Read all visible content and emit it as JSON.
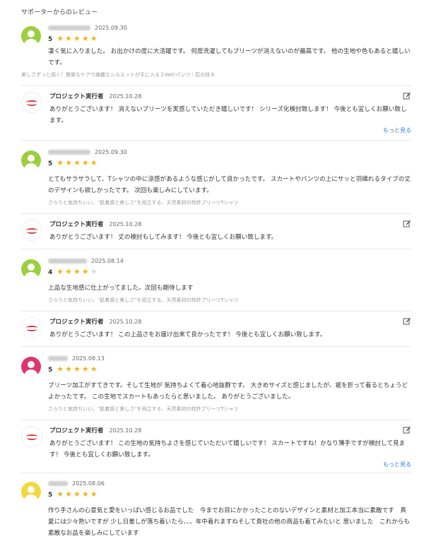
{
  "section_title": "サポーターからのレビュー",
  "colors": {
    "star": "#f0b41c",
    "link": "#2a7fd4"
  },
  "reviews": [
    {
      "avatar_color": "#9bcf3f",
      "date": "2025.09.30",
      "rating": "5",
      "stars": "★★★★★",
      "stars_off": "",
      "text": "凄く気に入りました。 お出かけの度に大活躍です。 何度洗濯してもプリーツが消えないのが最高です。 他の生地や色もあると嬉しいです。",
      "product": "美しさずっと続く！簡単なケアで綺麗なシルエットが手に入る２WAYパンツ｜匠の技８",
      "reply": {
        "owner": "プロジェクト実行者",
        "date": "2025.10.28",
        "text": "ありがとうございます！ 消えないプリーツを実感していただき嬉しいです！ シリーズ化検討致します！ 今後とも宜しくお願い致します。",
        "more": "もっと見る"
      }
    },
    {
      "avatar_color": "#9bcf3f",
      "date": "2025.09.30",
      "rating": "5",
      "stars": "★★★★★",
      "stars_off": "",
      "text": "とてもサラサラして、Tシャツの中に涼感があるような感じがして良かったです。 スカートやパンツの上にサッと羽織れるタイプの丈のデザインも欲しかったです。 次回も楽しみにしています。",
      "product": "さらりと気持ちいい。\"肌着感と美しさ\"を両立する、天然素材の特許プリーツTシャツ",
      "reply": {
        "owner": "プロジェクト実行者",
        "date": "2025.10.28",
        "text": "ありがとうございます！ 丈の検討もしてみます！ 今後とも宜しくお願い致します。",
        "more": ""
      }
    },
    {
      "avatar_color": "#9bcf3f",
      "date": "2025.08.14",
      "rating": "4",
      "stars": "★★★★",
      "stars_off": "★",
      "text": "上品な生地感に仕上がってました。次回も期待します",
      "product": "さらりと気持ちいい。\"肌着感と美しさ\"を両立する、天然素材の特許プリーツTシャツ",
      "reply": {
        "owner": "プロジェクト実行者",
        "date": "2025.10.28",
        "text": "ありがとうございます！ この上品さをお届け出来て良かったです！ 今後とも宜しくお願い致します。",
        "more": ""
      }
    },
    {
      "avatar_color": "#e0336f",
      "date": "2025.08.13",
      "rating": "5",
      "stars": "★★★★★",
      "stars_off": "",
      "text": "プリーツ加工がすてきです。そして生地が 気持ちよくて着心地抜群です。 大きめサイズと感じましたが、裾を折って着るとちょうどよかったです。 この生地でスカートもあったらと思いました。 ありがとうございました。",
      "product": "さらりと気持ちいい。\"肌着感と美しさ\"を両立する、天然素材の特許プリーツTシャツ",
      "reply": {
        "owner": "プロジェクト実行者",
        "date": "2025.10.28",
        "text": "ありがとうございます！ この生地の気持ちよさを感じていただいて嬉しいです！ スカートですね！かなり薄手ですが検討して見ます！ 今後とも宜しくお願い致します。",
        "more": "もっと見る"
      }
    },
    {
      "avatar_color": "#f2d83a",
      "date": "2025.08.06",
      "rating": "5",
      "stars": "★★★★★",
      "stars_off": "",
      "text": "作り手さんの心意気と愛をいっぱい感じるお品でした　今までお目にかかったことのないデザインと素材と加工本当に素敵です　真夏には少々熱いですが 少し日差しが落ち着いたら、、、年中着れますねそして貴社の他の商品も着てみたいと 思いました　これからも素敵なお品を楽しみにしています"
    }
  ]
}
